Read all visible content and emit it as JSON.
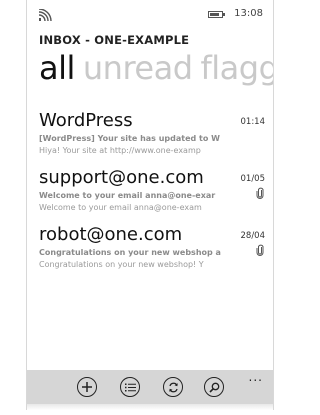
{
  "status_bar": {
    "time": "13:08",
    "icons": [
      "signal-icon",
      "battery-icon"
    ]
  },
  "header": {
    "account_title": "INBOX - ONE-EXAMPLE"
  },
  "pivot": {
    "tabs": [
      {
        "label": "all",
        "active": true
      },
      {
        "label": "unread",
        "active": false
      },
      {
        "label": "flagg",
        "active": false
      }
    ]
  },
  "messages": [
    {
      "sender": "WordPress",
      "subject": "[WordPress] Your site has updated to W",
      "preview": "Hiya! Your site at http://www.one-examp",
      "date": "01:14",
      "has_attachment": false
    },
    {
      "sender": "support@one.com",
      "subject": "Welcome to your email anna@one-exar",
      "preview": "Welcome to your email anna@one-exam",
      "date": "01/05",
      "has_attachment": true
    },
    {
      "sender": "robot@one.com",
      "subject": "Congratulations on your new webshop a",
      "preview": "Congratulations on your new webshop! Y",
      "date": "28/04",
      "has_attachment": true
    }
  ],
  "app_bar": {
    "buttons": [
      "new-icon",
      "select-icon",
      "sync-icon",
      "search-icon"
    ],
    "more": "..."
  },
  "colors": {
    "app_bar_bg": "#d6d6d6",
    "inactive_tab": "#c9c9c9",
    "text_primary": "#111111",
    "text_secondary": "#8a8a8a"
  }
}
